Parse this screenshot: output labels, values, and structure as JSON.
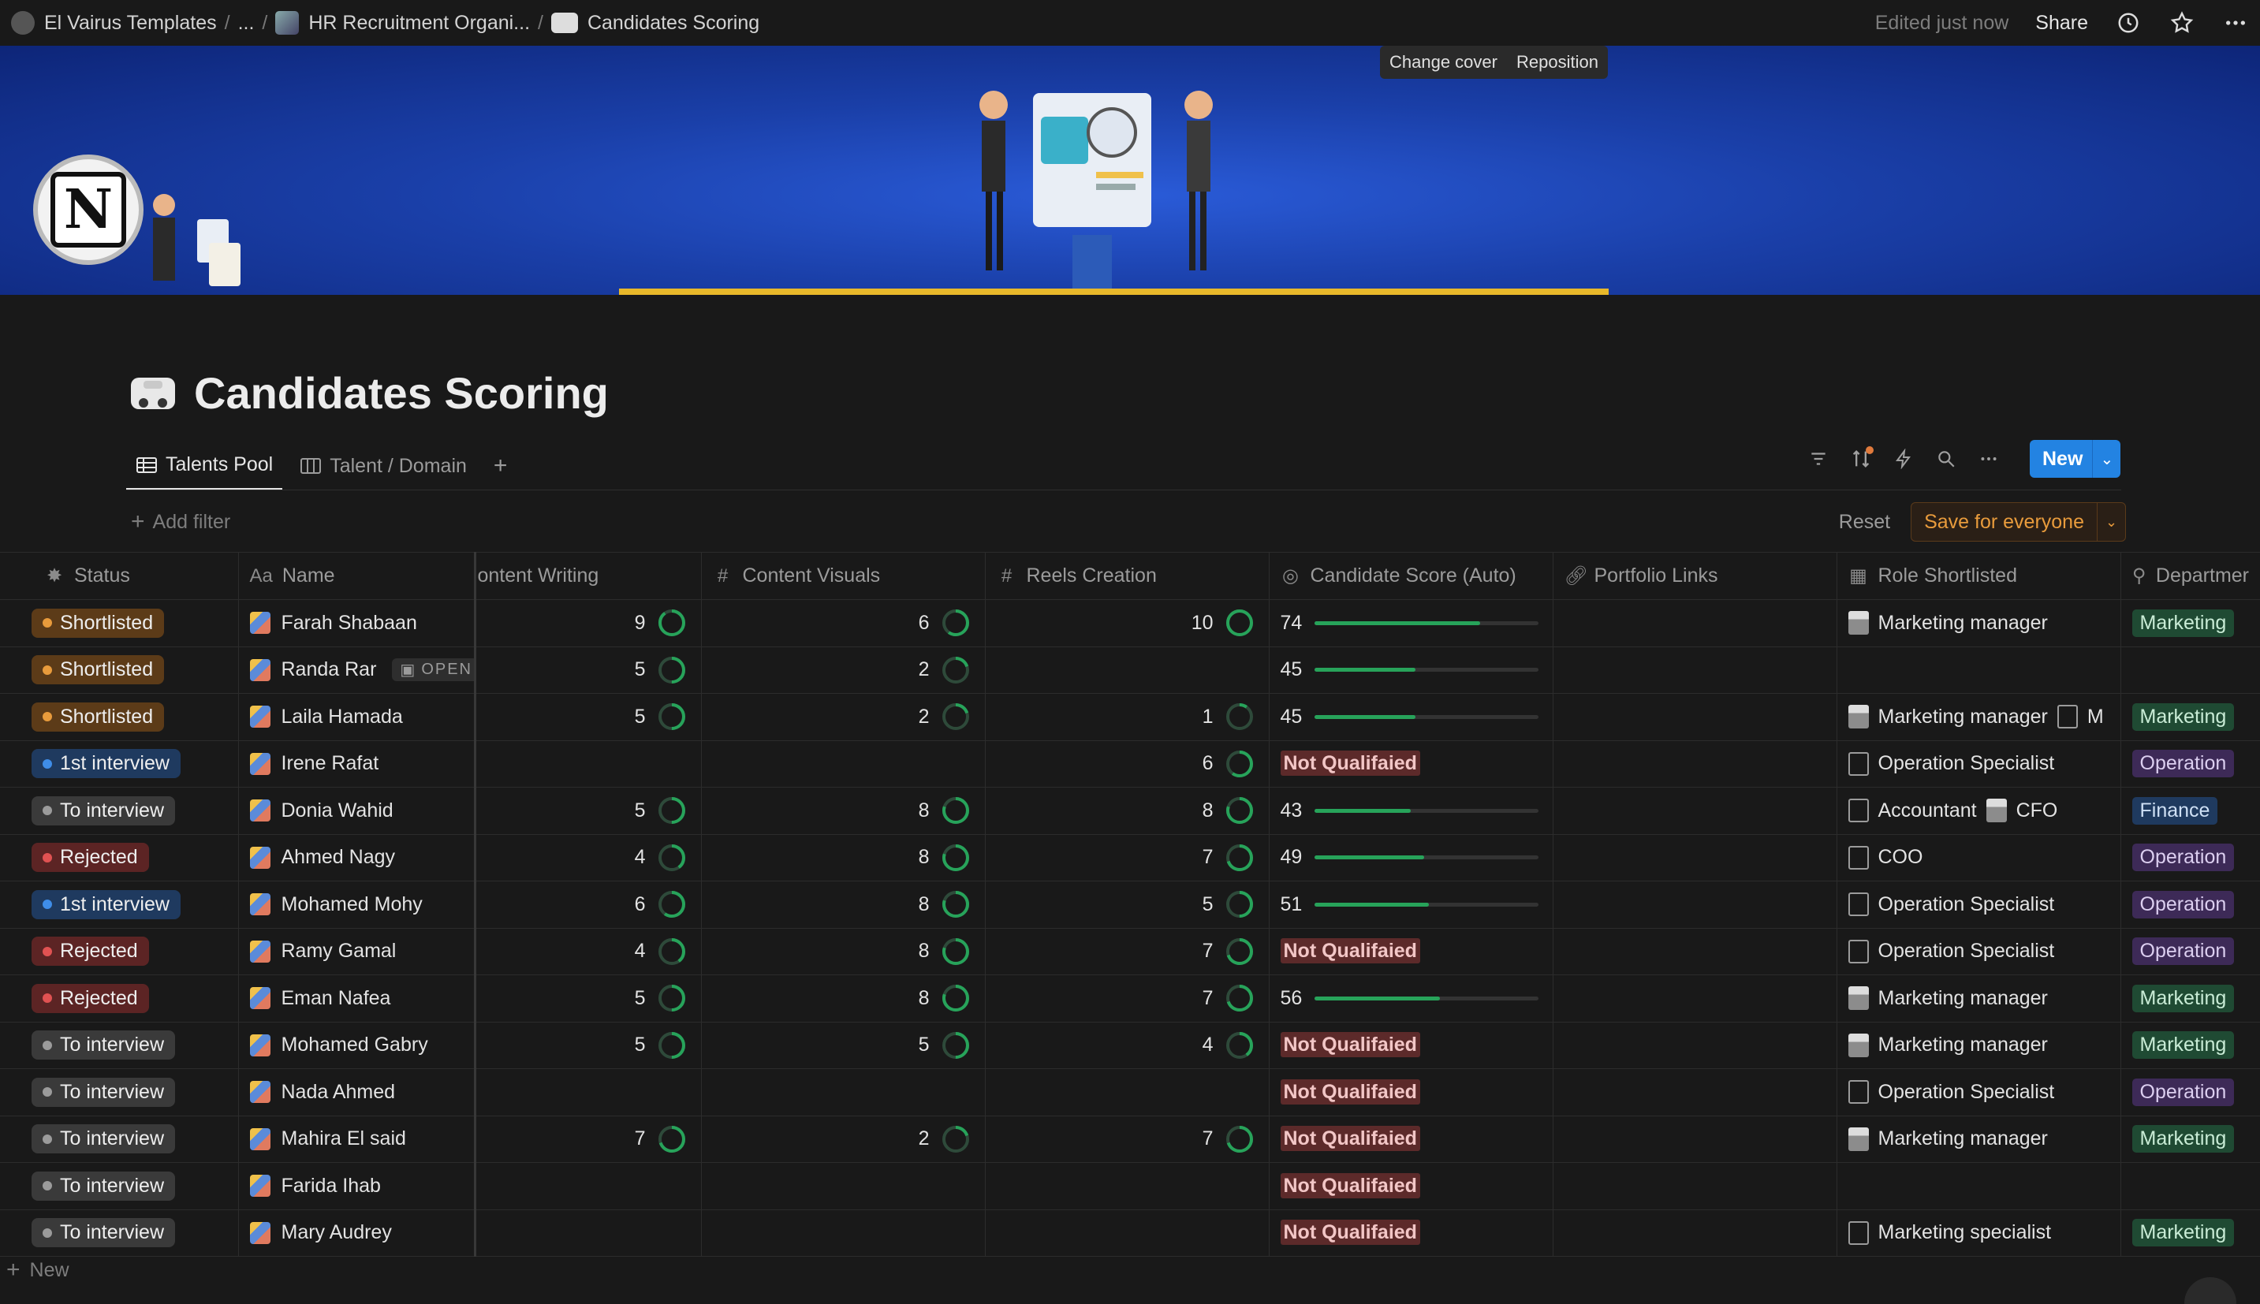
{
  "breadcrumbs": [
    {
      "label": "El Vairus Templates",
      "icon": "avatar-icon"
    },
    {
      "label": "...",
      "icon": ""
    },
    {
      "label": "HR Recruitment Organi...",
      "icon": "hr-page-icon"
    },
    {
      "label": "Candidates Scoring",
      "icon": "car-icon"
    }
  ],
  "topbar": {
    "edited": "Edited just now",
    "share": "Share"
  },
  "cover": {
    "change_cover": "Change cover",
    "reposition": "Reposition",
    "logo_letter": "N"
  },
  "page": {
    "title": "Candidates Scoring"
  },
  "views": [
    {
      "label": "Talents Pool",
      "icon": "table-icon",
      "active": true
    },
    {
      "label": "Talent / Domain",
      "icon": "board-icon",
      "active": false
    }
  ],
  "toolbar": {
    "new_label": "New"
  },
  "filter": {
    "add_filter": "Add filter",
    "reset": "Reset",
    "save": "Save for everyone"
  },
  "columns": {
    "status": "Status",
    "name_prefix": "Aa",
    "name": "Name",
    "content_writing": "ontent Writing",
    "content_visuals": "Content Visuals",
    "reels_creation": "Reels Creation",
    "candidate_score": "Candidate Score (Auto)",
    "portfolio": "Portfolio Links",
    "role": "Role Shortlisted",
    "department": "Departmer"
  },
  "status_colors": {
    "Shortlisted": {
      "bg": "#5c3b18",
      "dot": "#e89b3c"
    },
    "1st interview": {
      "bg": "#1f3a5f",
      "dot": "#3f8de8"
    },
    "To interview": {
      "bg": "#3a3a3a",
      "dot": "#9b9b9b"
    },
    "Rejected": {
      "bg": "#5c2424",
      "dot": "#e05252"
    }
  },
  "dept_colors": {
    "Marketing": {
      "bg": "#1f4a33",
      "fg": "#c9ecd6"
    },
    "Operation": {
      "bg": "#3d2a57",
      "fg": "#dccff0"
    },
    "Finance": {
      "bg": "#1f3a5f",
      "fg": "#cfe0f5"
    }
  },
  "rows": [
    {
      "status": "Shortlisted",
      "name": "Farah Shabaan",
      "open": false,
      "cw": 9,
      "cv": 6,
      "rc": 10,
      "score": 74,
      "score_text": "74",
      "roles": [
        {
          "label": "Marketing manager",
          "icon": "doc2"
        }
      ],
      "dept": "Marketing"
    },
    {
      "status": "Shortlisted",
      "name": "Randa Rar",
      "open": true,
      "open_label": "OPEN",
      "cw": 5,
      "cv": 2,
      "rc": null,
      "score": 45,
      "score_text": "45",
      "roles": [],
      "dept": ""
    },
    {
      "status": "Shortlisted",
      "name": "Laila Hamada",
      "open": false,
      "cw": 5,
      "cv": 2,
      "rc": 1,
      "score": 45,
      "score_text": "45",
      "roles": [
        {
          "label": "Marketing manager",
          "icon": "doc2"
        },
        {
          "label": "M",
          "icon": "file"
        }
      ],
      "dept": "Marketing"
    },
    {
      "status": "1st interview",
      "name": "Irene Rafat",
      "open": false,
      "cw": null,
      "cv": null,
      "rc": 6,
      "score": null,
      "score_text": "Not Qualifaied",
      "roles": [
        {
          "label": "Operation Specialist",
          "icon": "file"
        }
      ],
      "dept": "Operation"
    },
    {
      "status": "To interview",
      "name": "Donia Wahid",
      "open": false,
      "cw": 5,
      "cv": 8,
      "rc": 8,
      "score": 43,
      "score_text": "43",
      "roles": [
        {
          "label": "Accountant",
          "icon": "file"
        },
        {
          "label": "CFO",
          "icon": "doc2"
        }
      ],
      "dept": "Finance"
    },
    {
      "status": "Rejected",
      "name": "Ahmed Nagy",
      "open": false,
      "cw": 4,
      "cv": 8,
      "rc": 7,
      "score": 49,
      "score_text": "49",
      "roles": [
        {
          "label": "COO",
          "icon": "file"
        }
      ],
      "dept": "Operation"
    },
    {
      "status": "1st interview",
      "name": "Mohamed Mohy",
      "open": false,
      "cw": 6,
      "cv": 8,
      "rc": 5,
      "score": 51,
      "score_text": "51",
      "roles": [
        {
          "label": "Operation Specialist",
          "icon": "file"
        }
      ],
      "dept": "Operation"
    },
    {
      "status": "Rejected",
      "name": "Ramy Gamal",
      "open": false,
      "cw": 4,
      "cv": 8,
      "rc": 7,
      "score": null,
      "score_text": "Not Qualifaied",
      "roles": [
        {
          "label": "Operation Specialist",
          "icon": "file"
        }
      ],
      "dept": "Operation"
    },
    {
      "status": "Rejected",
      "name": "Eman Nafea",
      "open": false,
      "cw": 5,
      "cv": 8,
      "rc": 7,
      "score": 56,
      "score_text": "56",
      "roles": [
        {
          "label": "Marketing manager",
          "icon": "doc2"
        }
      ],
      "dept": "Marketing"
    },
    {
      "status": "To interview",
      "name": "Mohamed Gabry",
      "open": false,
      "cw": 5,
      "cv": 5,
      "rc": 4,
      "score": null,
      "score_text": "Not Qualifaied",
      "roles": [
        {
          "label": "Marketing manager",
          "icon": "doc2"
        }
      ],
      "dept": "Marketing"
    },
    {
      "status": "To interview",
      "name": "Nada Ahmed",
      "open": false,
      "cw": null,
      "cv": null,
      "rc": null,
      "score": null,
      "score_text": "Not Qualifaied",
      "roles": [
        {
          "label": "Operation Specialist",
          "icon": "file"
        }
      ],
      "dept": "Operation"
    },
    {
      "status": "To interview",
      "name": "Mahira El said",
      "open": false,
      "cw": 7,
      "cv": 2,
      "rc": 7,
      "score": null,
      "score_text": "Not Qualifaied",
      "roles": [
        {
          "label": "Marketing manager",
          "icon": "doc2"
        }
      ],
      "dept": "Marketing"
    },
    {
      "status": "To interview",
      "name": "Farida Ihab",
      "open": false,
      "cw": null,
      "cv": null,
      "rc": null,
      "score": null,
      "score_text": "Not Qualifaied",
      "roles": [],
      "dept": ""
    },
    {
      "status": "To interview",
      "name": "Mary Audrey",
      "open": false,
      "cw": null,
      "cv": null,
      "rc": null,
      "score": null,
      "score_text": "Not Qualifaied",
      "roles": [
        {
          "label": "Marketing specialist",
          "icon": "file"
        }
      ],
      "dept": "Marketing"
    }
  ],
  "footer": {
    "new_label": "New"
  }
}
